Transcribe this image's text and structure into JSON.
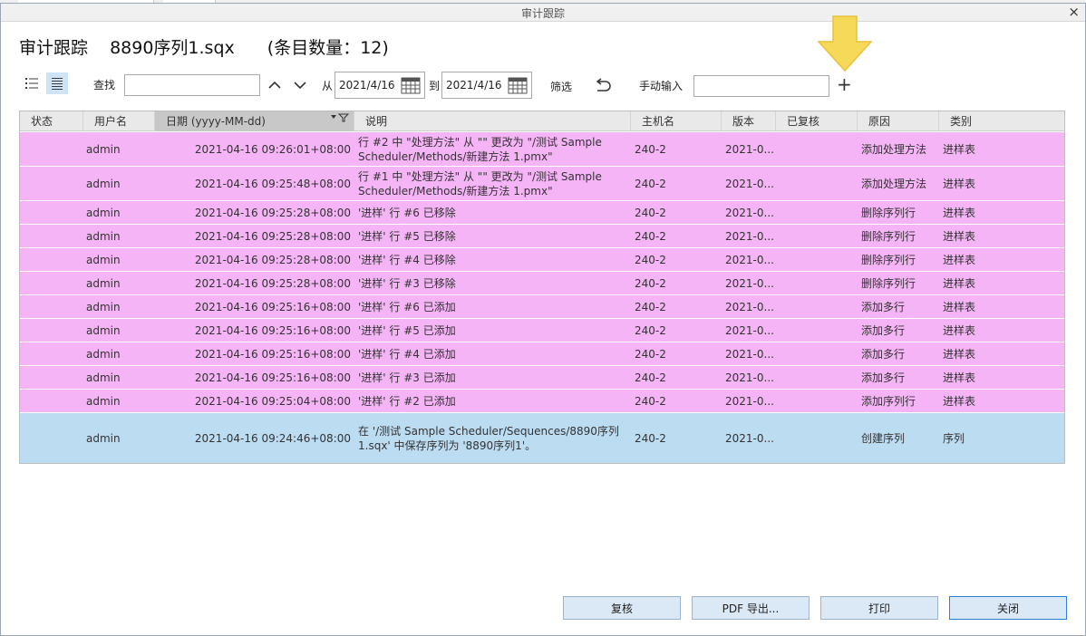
{
  "window": {
    "title": "审计跟踪",
    "close_glyph": "×"
  },
  "heading": {
    "title": "审计跟踪",
    "file": "8890序列1.sqx",
    "count": "(条目数量：12)"
  },
  "toolbar": {
    "search_label": "查找",
    "search_value": "",
    "from_label": "从",
    "from_date": "2021/4/16",
    "to_label": "到",
    "to_date": "2021/4/16",
    "filter_label": "筛选",
    "manual_label": "手动输入",
    "manual_value": "",
    "add_glyph": "+"
  },
  "columns": [
    "状态",
    "用户名",
    "日期 (yyyy-MM-dd)",
    "说明",
    "主机名",
    "版本",
    "已复核",
    "原因",
    "类别"
  ],
  "rows": [
    {
      "status": "",
      "user": "admin",
      "date": "2021-04-16 09:26:01+08:00",
      "desc": "行 #2 中 \"处理方法\" 从 \"\" 更改为 \"/测试 Sample Scheduler/Methods/新建方法 1.pmx\"",
      "host": "240-2",
      "version": "2021-0...",
      "reviewed": "",
      "reason": "添加处理方法",
      "category": "进样表",
      "color": "pink",
      "tall": 2
    },
    {
      "status": "",
      "user": "admin",
      "date": "2021-04-16 09:25:48+08:00",
      "desc": "行 #1 中 \"处理方法\" 从 \"\" 更改为 \"/测试 Sample Scheduler/Methods/新建方法 1.pmx\"",
      "host": "240-2",
      "version": "2021-0...",
      "reviewed": "",
      "reason": "添加处理方法",
      "category": "进样表",
      "color": "pink",
      "tall": 2
    },
    {
      "status": "",
      "user": "admin",
      "date": "2021-04-16 09:25:28+08:00",
      "desc": "'进样' 行 #6 已移除",
      "host": "240-2",
      "version": "2021-0...",
      "reviewed": "",
      "reason": "删除序列行",
      "category": "进样表",
      "color": "pink",
      "tall": 1
    },
    {
      "status": "",
      "user": "admin",
      "date": "2021-04-16 09:25:28+08:00",
      "desc": "'进样' 行 #5 已移除",
      "host": "240-2",
      "version": "2021-0...",
      "reviewed": "",
      "reason": "删除序列行",
      "category": "进样表",
      "color": "pink",
      "tall": 1
    },
    {
      "status": "",
      "user": "admin",
      "date": "2021-04-16 09:25:28+08:00",
      "desc": "'进样' 行 #4 已移除",
      "host": "240-2",
      "version": "2021-0...",
      "reviewed": "",
      "reason": "删除序列行",
      "category": "进样表",
      "color": "pink",
      "tall": 1
    },
    {
      "status": "",
      "user": "admin",
      "date": "2021-04-16 09:25:28+08:00",
      "desc": "'进样' 行 #3 已移除",
      "host": "240-2",
      "version": "2021-0...",
      "reviewed": "",
      "reason": "删除序列行",
      "category": "进样表",
      "color": "pink",
      "tall": 1
    },
    {
      "status": "",
      "user": "admin",
      "date": "2021-04-16 09:25:16+08:00",
      "desc": "'进样' 行 #6 已添加",
      "host": "240-2",
      "version": "2021-0...",
      "reviewed": "",
      "reason": "添加多行",
      "category": "进样表",
      "color": "pink",
      "tall": 1
    },
    {
      "status": "",
      "user": "admin",
      "date": "2021-04-16 09:25:16+08:00",
      "desc": "'进样' 行 #5 已添加",
      "host": "240-2",
      "version": "2021-0...",
      "reviewed": "",
      "reason": "添加多行",
      "category": "进样表",
      "color": "pink",
      "tall": 1
    },
    {
      "status": "",
      "user": "admin",
      "date": "2021-04-16 09:25:16+08:00",
      "desc": "'进样' 行 #4 已添加",
      "host": "240-2",
      "version": "2021-0...",
      "reviewed": "",
      "reason": "添加多行",
      "category": "进样表",
      "color": "pink",
      "tall": 1
    },
    {
      "status": "",
      "user": "admin",
      "date": "2021-04-16 09:25:16+08:00",
      "desc": "'进样' 行 #3 已添加",
      "host": "240-2",
      "version": "2021-0...",
      "reviewed": "",
      "reason": "添加多行",
      "category": "进样表",
      "color": "pink",
      "tall": 1
    },
    {
      "status": "",
      "user": "admin",
      "date": "2021-04-16 09:25:04+08:00",
      "desc": "'进样' 行 #2 已添加",
      "host": "240-2",
      "version": "2021-0...",
      "reviewed": "",
      "reason": "添加序列行",
      "category": "进样表",
      "color": "pink",
      "tall": 1
    },
    {
      "status": "",
      "user": "admin",
      "date": "2021-04-16 09:24:46+08:00",
      "desc": "在 '/测试 Sample Scheduler/Sequences/8890序列1.sqx' 中保存序列为 '8890序列1'。",
      "host": "240-2",
      "version": "2021-0...",
      "reviewed": "",
      "reason": "创建序列",
      "category": "序列",
      "color": "blue",
      "tall": 3
    }
  ],
  "buttons": {
    "review": "复核",
    "pdf": "PDF 导出...",
    "print": "打印",
    "close": "关闭"
  },
  "colors": {
    "row_pink": "#f5b4f5",
    "row_blue": "#bcdcf2",
    "header_bg": "#e9e9e9",
    "button_bg": "#dbe8f5",
    "arrow": "#f7d95a"
  },
  "icons": [
    "list-view-icon",
    "detail-view-icon",
    "up-arrow-icon",
    "down-arrow-icon",
    "calendar-icon",
    "undo-icon",
    "add-icon",
    "filter-icon",
    "close-icon",
    "pointer-arrow-icon"
  ]
}
